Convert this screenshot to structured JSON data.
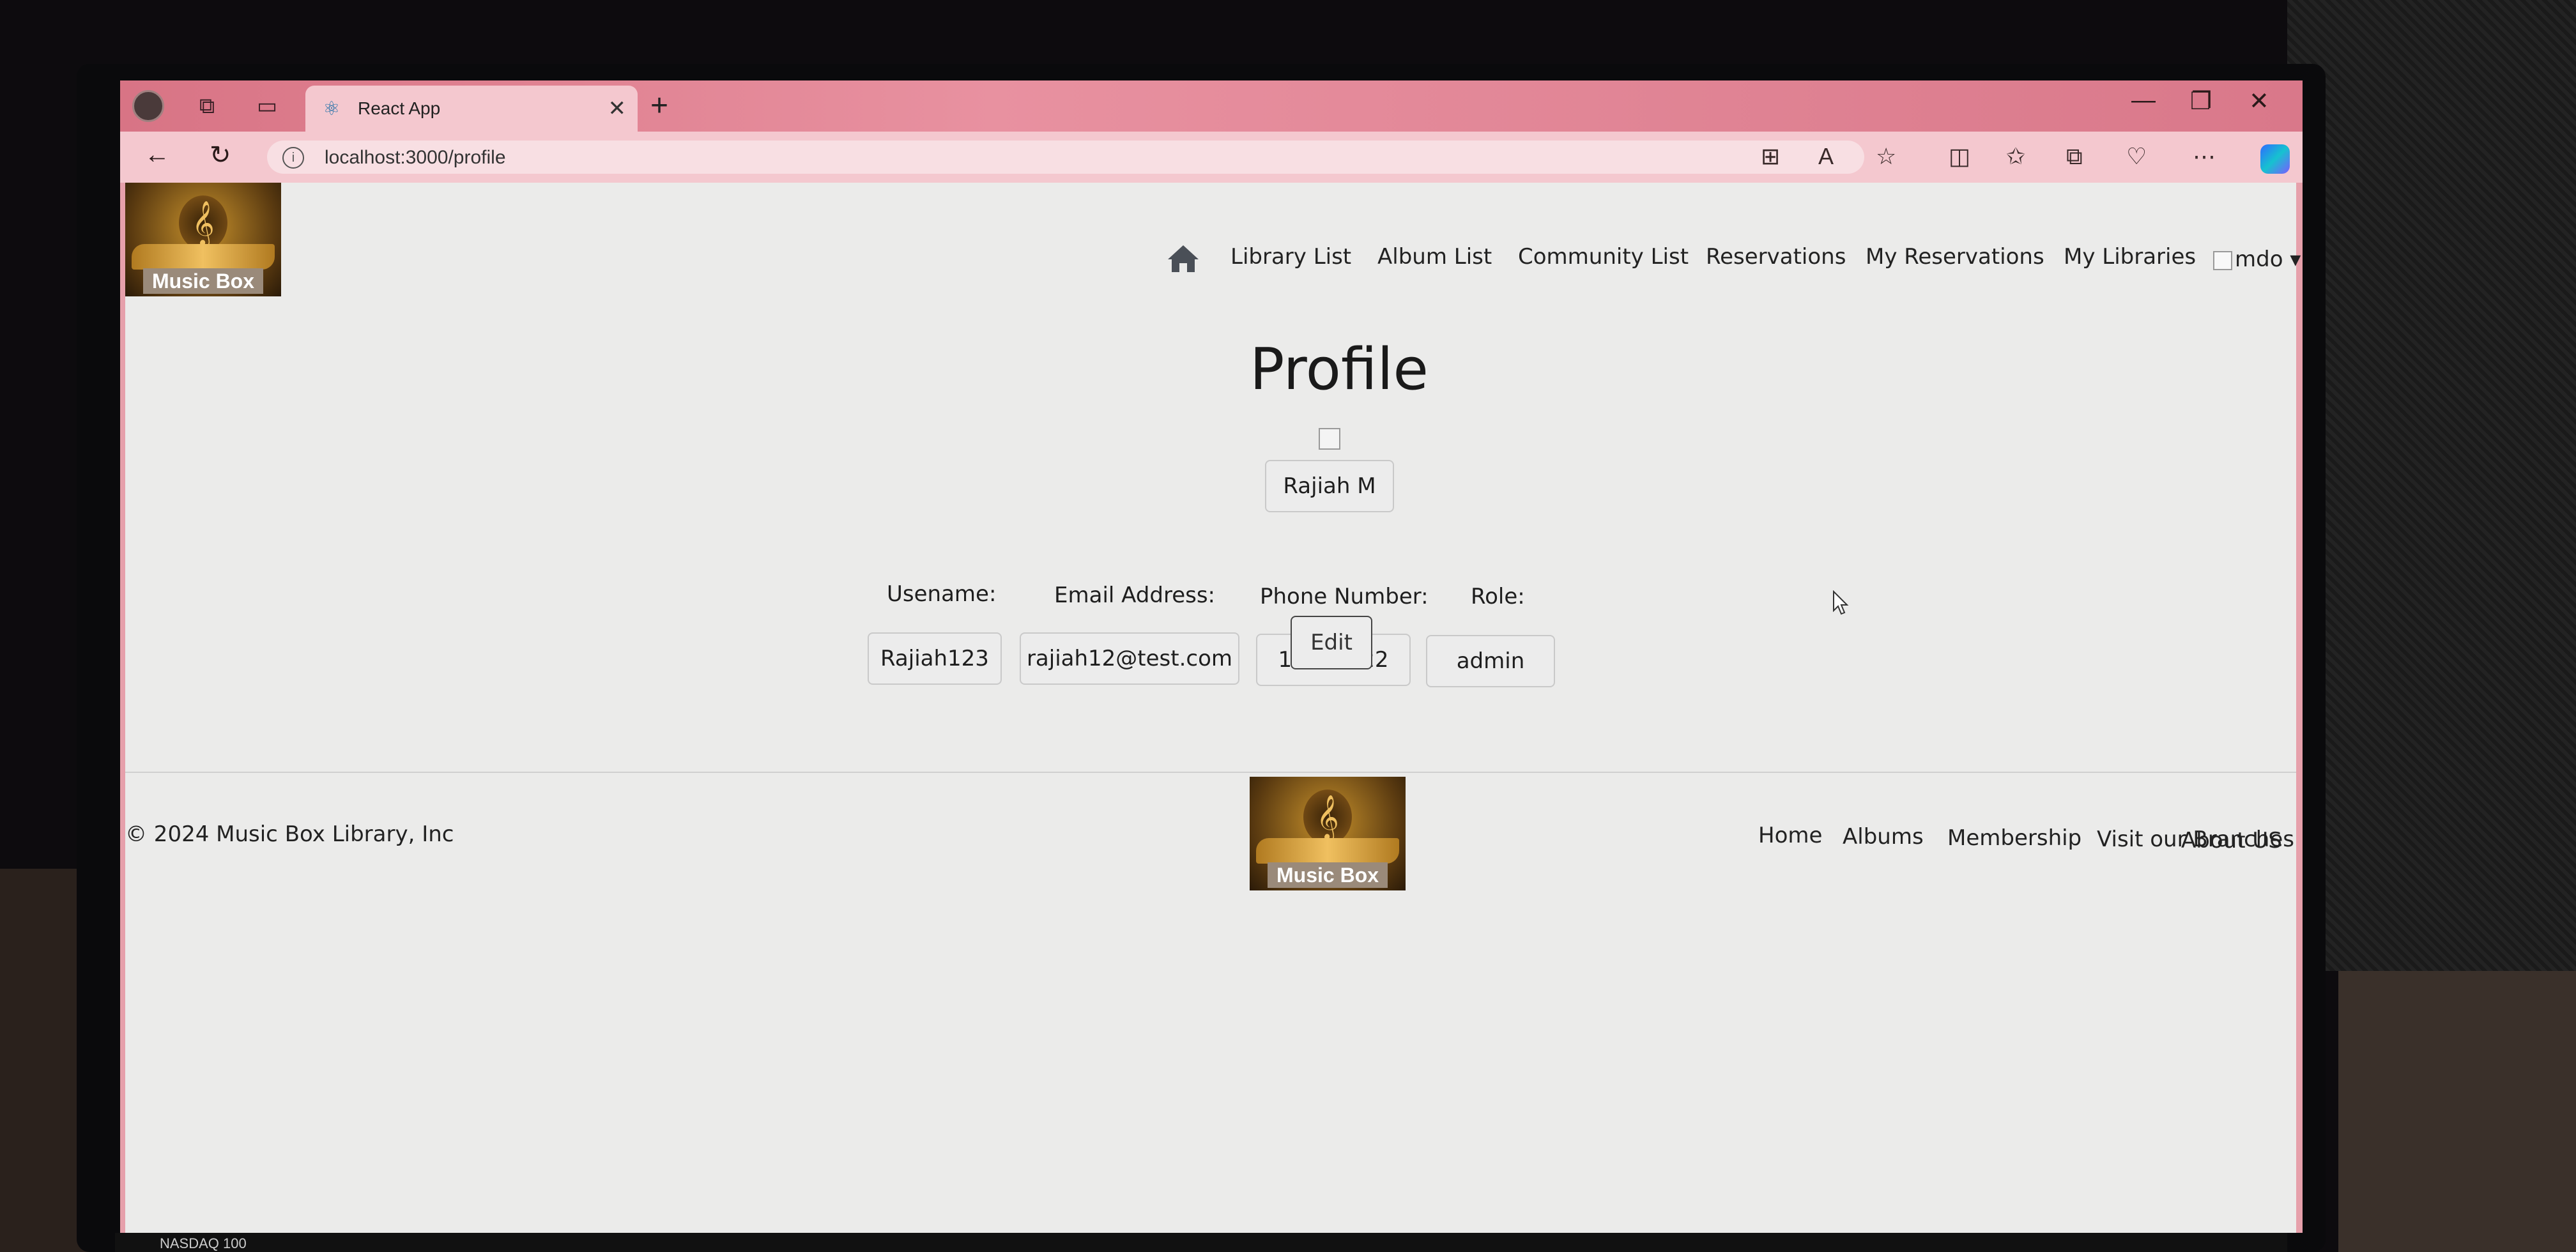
{
  "taskbar": {
    "ticker": "NASDAQ 100"
  },
  "browser": {
    "tab_title": "React App",
    "url": "localhost:3000/profile"
  },
  "site": {
    "logo_text": "Music Box",
    "nav": {
      "items": [
        "Library List",
        "Album List",
        "Community List",
        "Reservations",
        "My Reservations",
        "My Libraries"
      ],
      "user": "mdo"
    }
  },
  "profile": {
    "heading": "Profile",
    "full_name": "Rajiah M",
    "fields": [
      {
        "label": "Usename:",
        "value": "Rajiah123"
      },
      {
        "label": "Email Address:",
        "value": "rajiah12@test.com"
      },
      {
        "label": "Phone Number:",
        "value": "11445522"
      },
      {
        "label": "Role:",
        "value": "admin"
      }
    ],
    "edit_label": "Edit"
  },
  "footer": {
    "copyright": "© 2024 Music Box Library, Inc",
    "links": [
      "Home",
      "Albums",
      "Membership",
      "Visit our Branches",
      "About US"
    ]
  }
}
